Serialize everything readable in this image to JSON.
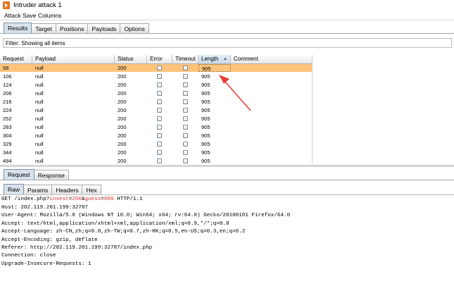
{
  "window": {
    "title": "Intruder attack 1"
  },
  "menu": [
    "Attack",
    "Save",
    "Columns"
  ],
  "top_tabs": [
    {
      "label": "Results",
      "active": true
    },
    {
      "label": "Target",
      "active": false
    },
    {
      "label": "Positions",
      "active": false
    },
    {
      "label": "Payloads",
      "active": false
    },
    {
      "label": "Options",
      "active": false
    }
  ],
  "filter": {
    "text": "Filter: Showing all items"
  },
  "table": {
    "columns": [
      "Request",
      "Payload",
      "Status",
      "Error",
      "Timeout",
      "Length",
      "Comment"
    ],
    "sorted_column": "Length",
    "rows": [
      {
        "request": "58",
        "payload": "null",
        "status": "200",
        "length": "905",
        "selected": true
      },
      {
        "request": "106",
        "payload": "null",
        "status": "200",
        "length": "905"
      },
      {
        "request": "124",
        "payload": "null",
        "status": "200",
        "length": "905"
      },
      {
        "request": "206",
        "payload": "null",
        "status": "200",
        "length": "905"
      },
      {
        "request": "216",
        "payload": "null",
        "status": "200",
        "length": "905"
      },
      {
        "request": "224",
        "payload": "null",
        "status": "200",
        "length": "905"
      },
      {
        "request": "252",
        "payload": "null",
        "status": "200",
        "length": "905"
      },
      {
        "request": "283",
        "payload": "null",
        "status": "200",
        "length": "905"
      },
      {
        "request": "304",
        "payload": "null",
        "status": "200",
        "length": "905"
      },
      {
        "request": "329",
        "payload": "null",
        "status": "200",
        "length": "905"
      },
      {
        "request": "344",
        "payload": "null",
        "status": "200",
        "length": "905"
      },
      {
        "request": "494",
        "payload": "null",
        "status": "200",
        "length": "905"
      }
    ]
  },
  "detail_tabs": [
    {
      "label": "Request",
      "active": true
    },
    {
      "label": "Response",
      "active": false
    }
  ],
  "view_tabs": [
    {
      "label": "Raw",
      "active": true
    },
    {
      "label": "Params",
      "active": false
    },
    {
      "label": "Headers",
      "active": false
    },
    {
      "label": "Hex",
      "active": false
    }
  ],
  "request_text": {
    "line1": {
      "prefix": "GET /index.php?",
      "p1": "invest",
      "eq1": "=",
      "v1": "200",
      "amp": "&",
      "p2": "guess",
      "eq2": "=",
      "v2": "800",
      "suffix": " HTTP/1.1"
    },
    "lines": [
      "Host: 202.119.201.199:32787",
      "User-Agent: Mozilla/5.0 (Windows NT 10.0; Win64; x64; rv:64.0) Gecko/20100101 Firefox/64.0",
      "Accept: text/html,application/xhtml+xml,application/xml;q=0.9,*/*;q=0.8",
      "Accept-Language: zh-CN,zh;q=0.8,zh-TW;q=0.7,zh-HK;q=0.5,en-US;q=0.3,en;q=0.2",
      "Accept-Encoding: gzip, deflate",
      "Referer: http://202.119.201.199:32787/index.php",
      "Connection: close",
      "Upgrade-Insecure-Requests: 1"
    ]
  },
  "colors": {
    "selected_row": "#ffc47b",
    "annotation_arrow": "#e8403a",
    "param_highlight": "#e03030"
  }
}
